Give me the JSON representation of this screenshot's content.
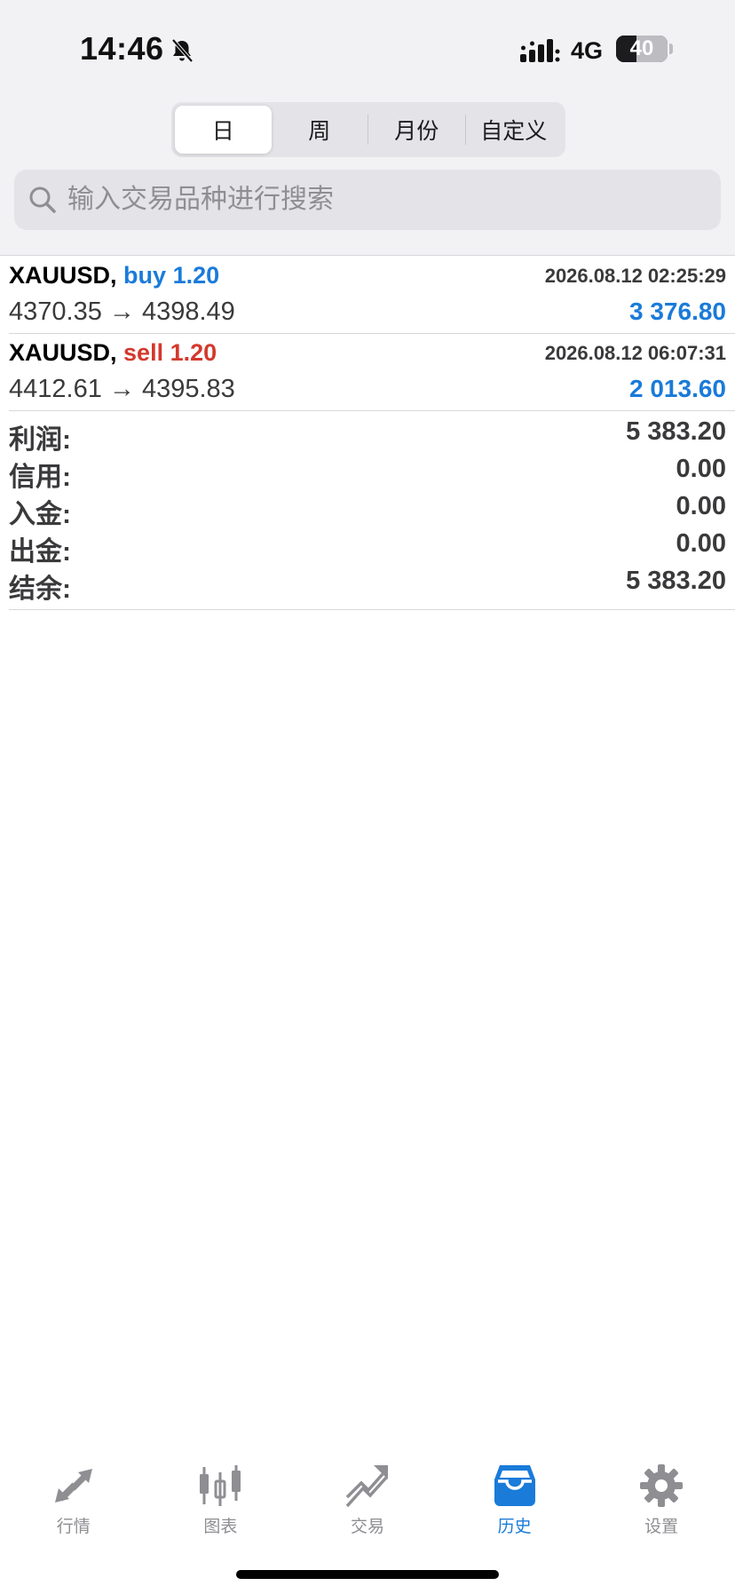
{
  "status_bar": {
    "time": "14:46",
    "network": "4G",
    "battery": "40",
    "battery_level": 0.4,
    "bell_icon": "bell-slash-icon",
    "signal_icon": "cellular-signal-icon"
  },
  "period_tabs": [
    {
      "label": "日",
      "active": true
    },
    {
      "label": "周",
      "active": false
    },
    {
      "label": "月份",
      "active": false
    },
    {
      "label": "自定义",
      "active": false
    }
  ],
  "search": {
    "placeholder": "输入交易品种进行搜索",
    "value": "",
    "icon": "search-icon"
  },
  "trades": [
    {
      "symbol": "XAUUSD,",
      "side": "buy",
      "volume": "1.20",
      "time": "2026.08.12 02:25:29",
      "open_price": "4370.35",
      "arrow": "→",
      "close_price": "4398.49",
      "profit": "3 376.80"
    },
    {
      "symbol": "XAUUSD,",
      "side": "sell",
      "volume": "1.20",
      "time": "2026.08.12 06:07:31",
      "open_price": "4412.61",
      "arrow": "→",
      "close_price": "4395.83",
      "profit": "2 013.60"
    }
  ],
  "summary": [
    {
      "label": "利润:",
      "value": "5 383.20"
    },
    {
      "label": "信用:",
      "value": "0.00"
    },
    {
      "label": "入金:",
      "value": "0.00"
    },
    {
      "label": "出金:",
      "value": "0.00"
    },
    {
      "label": "结余:",
      "value": "5 383.20"
    }
  ],
  "tab_bar": [
    {
      "label": "行情",
      "icon": "quotes-arrows-icon",
      "active": false
    },
    {
      "label": "图表",
      "icon": "candlestick-chart-icon",
      "active": false
    },
    {
      "label": "交易",
      "icon": "trade-trend-icon",
      "active": false
    },
    {
      "label": "历史",
      "icon": "history-inbox-icon",
      "active": true
    },
    {
      "label": "设置",
      "icon": "gear-icon",
      "active": false
    }
  ],
  "colors": {
    "accent": "#1a7bd9",
    "sell": "#d3392d",
    "inactive": "#8e8e93"
  }
}
